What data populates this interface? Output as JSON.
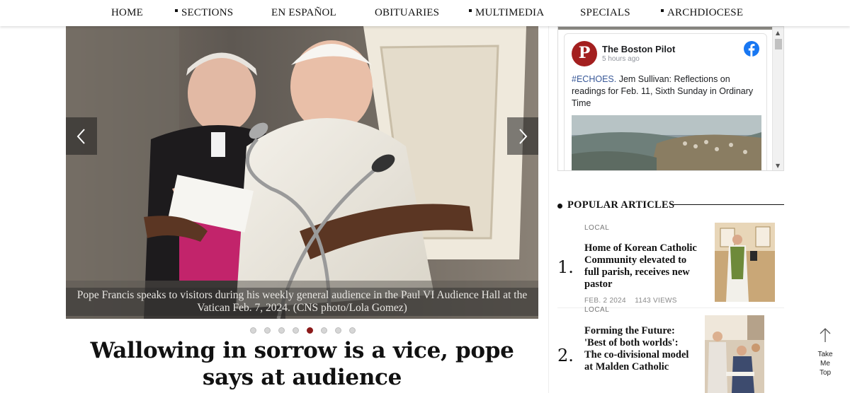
{
  "nav": {
    "items": [
      {
        "label": "HOME",
        "dropdown": false
      },
      {
        "label": "SECTIONS",
        "dropdown": true
      },
      {
        "label": "EN ESPAÑOL",
        "dropdown": false
      },
      {
        "label": "OBITUARIES",
        "dropdown": false
      },
      {
        "label": "MULTIMEDIA",
        "dropdown": true
      },
      {
        "label": "SPECIALS",
        "dropdown": false
      },
      {
        "label": "ARCHDIOCESE",
        "dropdown": true
      }
    ]
  },
  "slider": {
    "caption": "Pope Francis speaks to visitors during his weekly general audience in the Paul VI Audience Hall at the Vatican Feb. 7, 2024. (CNS photo/Lola Gomez)",
    "prev_icon": "chevron-left-icon",
    "next_icon": "chevron-right-icon",
    "dot_count": 8,
    "active_dot": 4,
    "headline": "Wallowing in sorrow is a vice, pope says at audience"
  },
  "facebook": {
    "page_name": "The Boston Pilot",
    "avatar_letter": "P",
    "time_ago": "5 hours ago",
    "hashtag": "#ECHOES.",
    "post_text": " Jem Sullivan: Reflections on readings for Feb. 11, Sixth Sunday in Ordinary Time",
    "brand_color": "#1877f2"
  },
  "popular": {
    "heading": "POPULAR ARTICLES",
    "articles": [
      {
        "rank": "1.",
        "category": "LOCAL",
        "title": "Home of Korean Catholic Community elevated to full parish, receives new pastor",
        "date": "FEB. 2 2024",
        "views": "1143 VIEWS"
      },
      {
        "rank": "2.",
        "category": "LOCAL",
        "title": "Forming the Future: 'Best of both worlds': The co-divisional model at Malden Catholic",
        "date": "",
        "views": ""
      }
    ]
  },
  "take_me_top": {
    "label_lines": [
      "Take",
      "Me",
      "Top"
    ],
    "icon": "arrow-up-icon"
  },
  "colors": {
    "accent": "#8b1a1a",
    "avatar_red": "#a31f1f",
    "facebook_blue": "#1877f2"
  }
}
